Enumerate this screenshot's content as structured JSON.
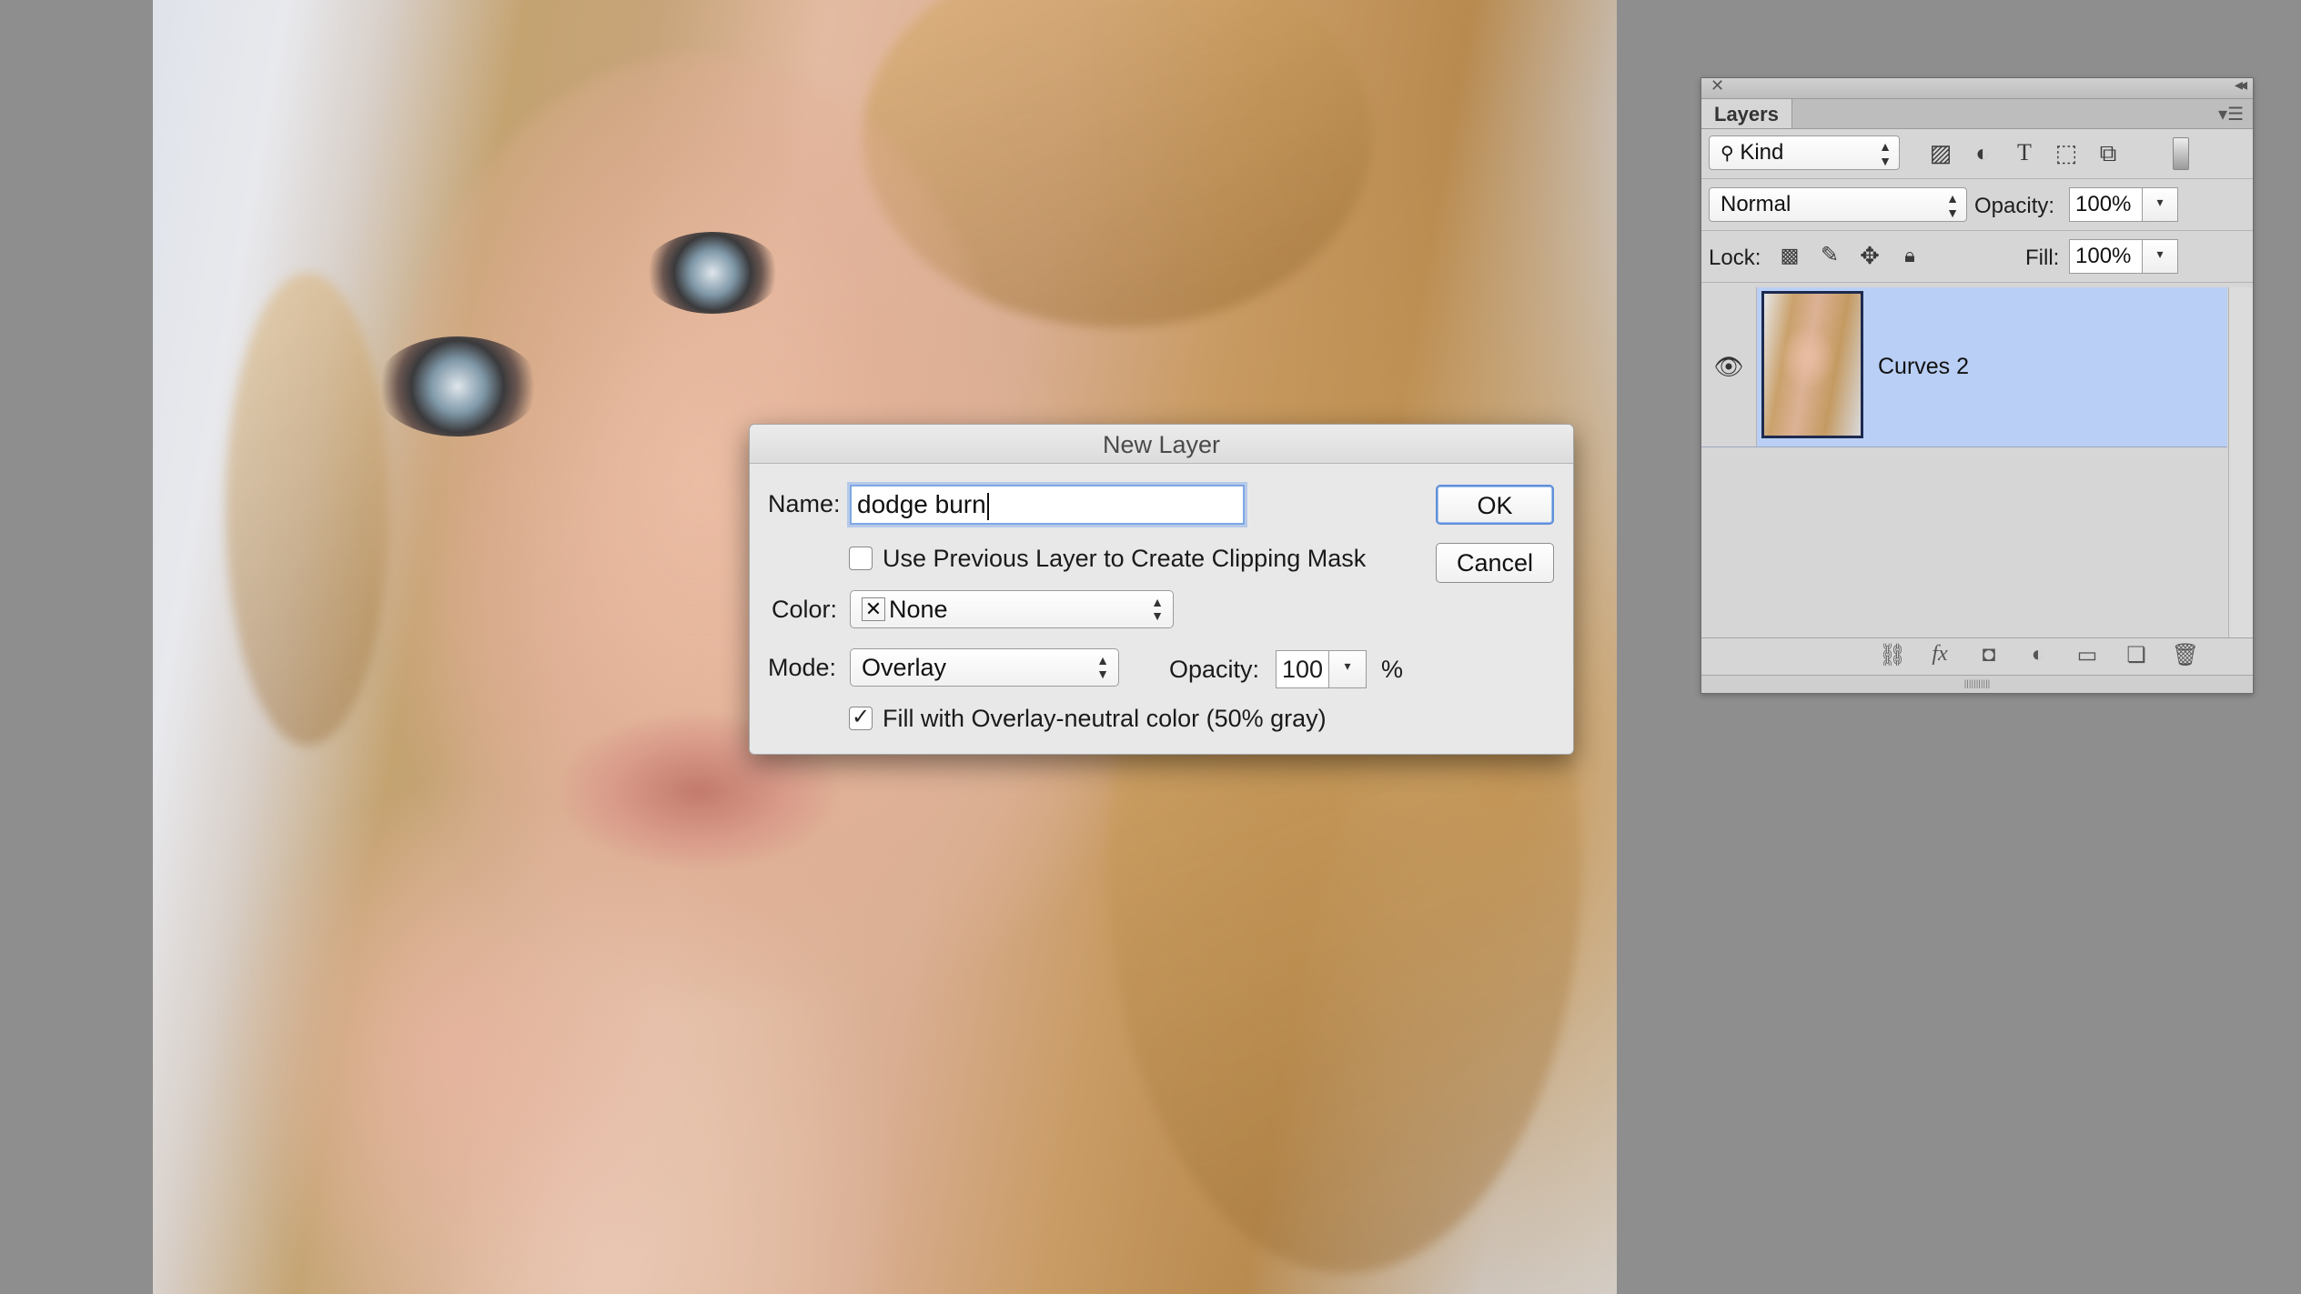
{
  "dialog": {
    "title": "New Layer",
    "name_label": "Name:",
    "name_value": "dodge burn",
    "ok_label": "OK",
    "cancel_label": "Cancel",
    "clipping_label": "Use Previous Layer to Create Clipping Mask",
    "clipping_checked": false,
    "color_label": "Color:",
    "color_value": "None",
    "mode_label": "Mode:",
    "mode_value": "Overlay",
    "opacity_label": "Opacity:",
    "opacity_value": "100",
    "opacity_unit": "%",
    "fill_label": "Fill with Overlay-neutral color (50% gray)",
    "fill_checked": true
  },
  "layers_panel": {
    "tab_label": "Layers",
    "filter_kind": "Kind",
    "blend_mode": "Normal",
    "opacity_label": "Opacity:",
    "opacity_value": "100%",
    "lock_label": "Lock:",
    "fill_label": "Fill:",
    "fill_value": "100%",
    "layers": [
      {
        "name": "Curves 2",
        "visible": true,
        "selected": true
      }
    ],
    "selection_color": "#b9cff5"
  }
}
